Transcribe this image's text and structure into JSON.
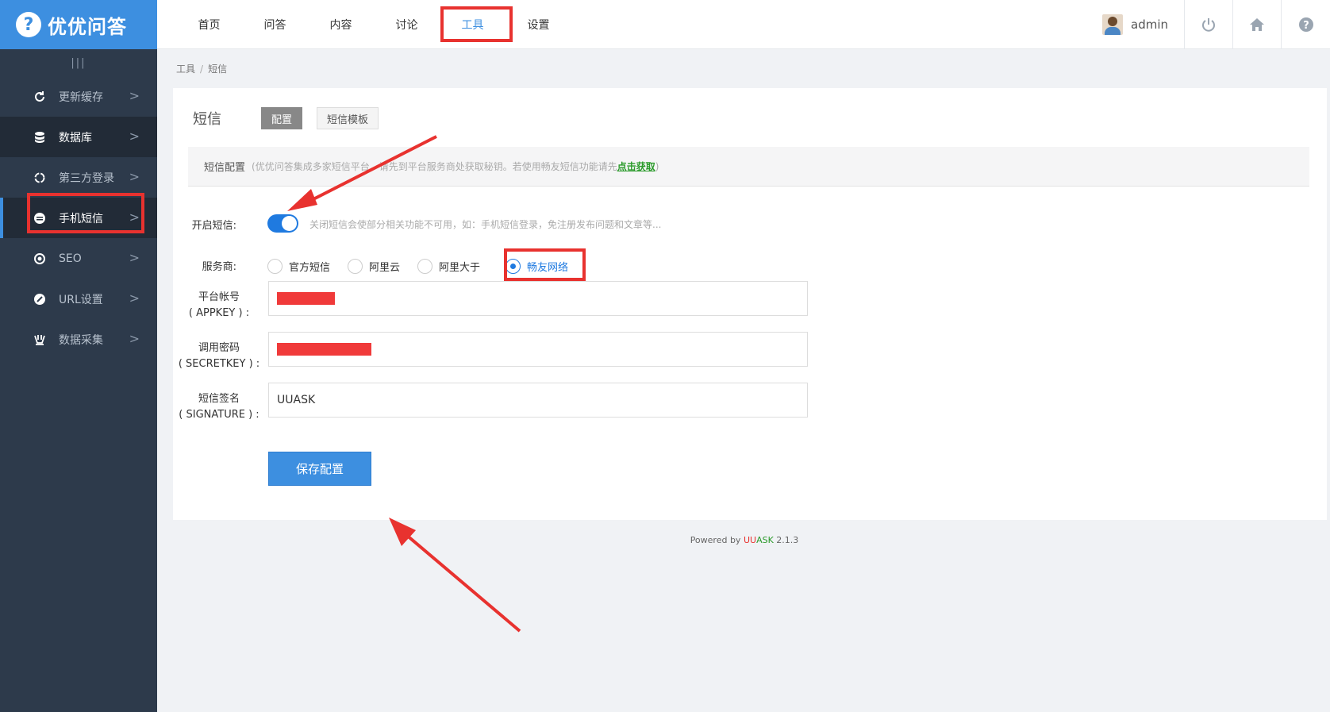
{
  "brand": {
    "logo_mark": "?",
    "name": "优优问答"
  },
  "sidebar": {
    "collapse_label": "|||",
    "items": [
      {
        "label": "更新缓存",
        "icon": "refresh-icon"
      },
      {
        "label": "数据库",
        "icon": "database-icon"
      },
      {
        "label": "第三方登录",
        "icon": "sync-icon"
      },
      {
        "label": "手机短信",
        "icon": "message-icon"
      },
      {
        "label": "SEO",
        "icon": "target-icon"
      },
      {
        "label": "URL设置",
        "icon": "link-icon"
      },
      {
        "label": "数据采集",
        "icon": "collect-icon"
      }
    ],
    "arrow": ">"
  },
  "topnav": {
    "items": [
      "首页",
      "问答",
      "内容",
      "讨论",
      "工具",
      "设置"
    ],
    "active": "工具",
    "user": "admin",
    "icons": [
      "power-icon",
      "home-icon",
      "help-icon"
    ]
  },
  "breadcrumb": {
    "first": "工具",
    "sep": "/",
    "second": "短信"
  },
  "panel": {
    "title": "短信",
    "tabs": [
      "配置",
      "短信模板"
    ],
    "notice": {
      "label": "短信配置",
      "text": "(优优问答集成多家短信平台，请先到平台服务商处获取秘钥。若使用畅友短信功能请先",
      "link": "点击获取",
      "close": ")"
    },
    "sms_enable": {
      "label": "开启短信:",
      "enabled": true,
      "hint": "关闭短信会使部分相关功能不可用，如：手机短信登录，免注册发布问题和文章等..."
    },
    "provider": {
      "label": "服务商:",
      "options": [
        "官方短信",
        "阿里云",
        "阿里大于",
        "畅友网络"
      ],
      "selected": "畅友网络"
    },
    "fields": [
      {
        "label1": "平台帐号",
        "label2": "( APPKEY ) :",
        "value": ""
      },
      {
        "label1": "调用密码",
        "label2": "( SECRETKEY ) :",
        "value": ""
      },
      {
        "label1": "短信签名",
        "label2": "( SIGNATURE ) :",
        "value": "UUASK"
      }
    ],
    "save_label": "保存配置"
  },
  "footer": {
    "prefix": "Powered by ",
    "brand_u": "UU",
    "brand_ask": "ASK",
    "version": " 2.1.3"
  },
  "colors": {
    "accent": "#3d8fe0",
    "sidebar": "#2d3a4b",
    "highlight": "#e8322f",
    "link": "#2a9a2a"
  }
}
